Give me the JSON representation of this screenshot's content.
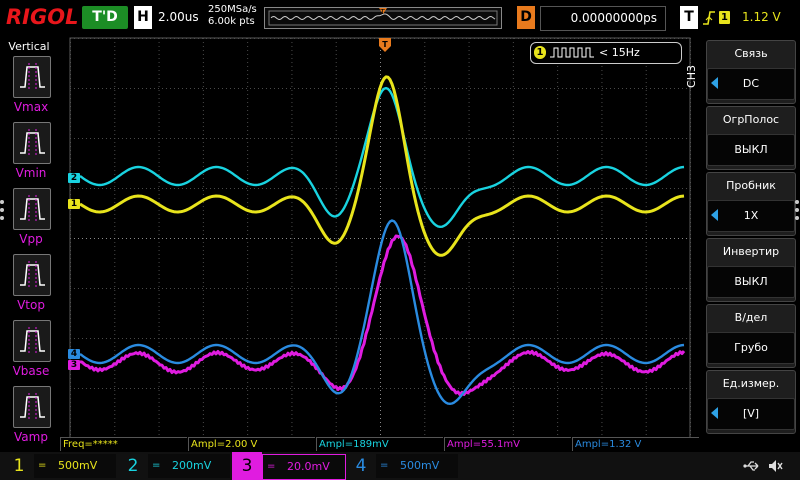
{
  "header": {
    "logo": "RIGOL",
    "trigger_state": "T'D",
    "horizontal_badge": "H",
    "horizontal_scale": "2.00us",
    "sample_rate": "250MSa/s",
    "memory_depth": "6.00k pts",
    "delay_badge": "D",
    "delay_value": "0.00000000ps",
    "trigger_badge": "T",
    "trigger_source": "1",
    "trigger_level": "1.12 V"
  },
  "left_panel": {
    "title": "Vertical",
    "items": [
      {
        "label": "Vmax"
      },
      {
        "label": "Vmin"
      },
      {
        "label": "Vpp"
      },
      {
        "label": "Vtop"
      },
      {
        "label": "Vbase"
      },
      {
        "label": "Vamp"
      }
    ]
  },
  "grid": {
    "trigger_marker": "T",
    "channel_markers": [
      {
        "label": "2",
        "color": "#19d3e0"
      },
      {
        "label": "1",
        "color": "#e8e41c"
      },
      {
        "label": "4",
        "color": "#2a8be0"
      },
      {
        "label": "3",
        "color": "#e01ce0"
      }
    ],
    "frequency_counter": {
      "channel": "1",
      "text": "< 15Hz"
    }
  },
  "right_menu": {
    "channel_tab": "CH3",
    "items": [
      {
        "label": "Связь",
        "value": "DC",
        "has_arrow": true
      },
      {
        "label": "ОгрПолос",
        "value": "ВЫКЛ",
        "has_arrow": false
      },
      {
        "label": "Пробник",
        "value": "1X",
        "has_arrow": true
      },
      {
        "label": "Инвертир",
        "value": "ВЫКЛ",
        "has_arrow": false
      },
      {
        "label": "В/дел",
        "value": "Грубо",
        "has_arrow": false
      },
      {
        "label": "Ед.измер.",
        "value": "[V]",
        "has_arrow": true
      }
    ]
  },
  "measurements": [
    {
      "text": "Freq=*****",
      "color": "#e8e41c"
    },
    {
      "text": "Ampl=2.00 V",
      "color": "#e8e41c"
    },
    {
      "text": "Ampl=189mV",
      "color": "#19d3e0"
    },
    {
      "text": "Ampl=55.1mV",
      "color": "#e01ce0"
    },
    {
      "text": "Ampl=1.32 V",
      "color": "#2a8be0"
    }
  ],
  "channels": [
    {
      "number": "1",
      "coupling": "=",
      "scale": "500mV",
      "color": "#e8e41c",
      "active": false
    },
    {
      "number": "2",
      "coupling": "=",
      "scale": "200mV",
      "color": "#19d3e0",
      "active": false
    },
    {
      "number": "3",
      "coupling": "=",
      "scale": "20.0mV",
      "color": "#e01ce0",
      "active": true
    },
    {
      "number": "4",
      "coupling": "=",
      "scale": "500mV",
      "color": "#2a8be0",
      "active": false
    }
  ],
  "colors": {
    "ch1": "#e8e41c",
    "ch2": "#19d3e0",
    "ch3": "#e01ce0",
    "ch4": "#2a8be0",
    "trigger": "#e87a1d",
    "menu_arrow": "#2ea2e6"
  },
  "status_icons": [
    "usb-icon",
    "speaker-mute-icon"
  ]
}
